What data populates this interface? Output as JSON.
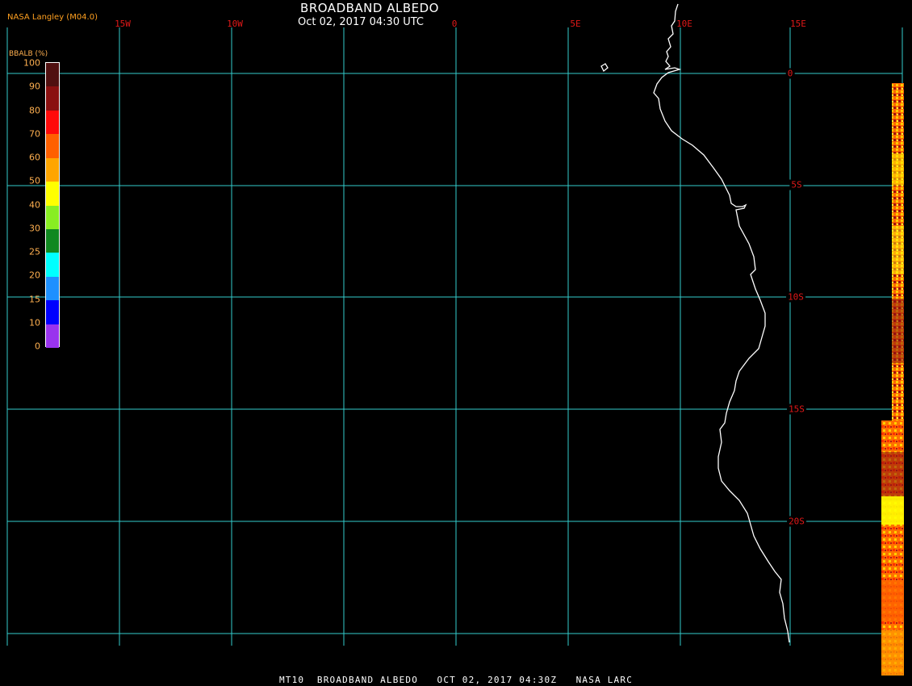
{
  "header": {
    "title": "BROADBAND ALBEDO",
    "timestamp": "Oct 02, 2017 04:30 UTC",
    "credit": "NASA Langley (M04.0)"
  },
  "footer": {
    "caption": "MT10  BROADBAND ALBEDO   OCT 02, 2017 04:30Z   NASA LARC"
  },
  "colors": {
    "grid": "#33cccc",
    "lon_label": "#e01818",
    "lat_label": "#e01818",
    "coastline": "#ffffff",
    "credit": "#ffa020",
    "legend_text": "#ffb050"
  },
  "map": {
    "longitude_labels": [
      "15W",
      "10W",
      "0",
      "5E",
      "10E",
      "15E"
    ],
    "latitude_labels": [
      "0",
      "5S",
      "10S",
      "15S",
      "20S"
    ]
  },
  "legend": {
    "title": "BBALB (%)",
    "ticks": [
      "100",
      "90",
      "80",
      "70",
      "60",
      "50",
      "40",
      "30",
      "25",
      "20",
      "15",
      "10",
      "0"
    ],
    "colors": [
      "#501010",
      "#8a1010",
      "#ff0a0a",
      "#ff6000",
      "#ffa500",
      "#ffff00",
      "#88ee22",
      "#108820",
      "#00ffff",
      "#1e90ff",
      "#0000ff",
      "#9933ee"
    ]
  }
}
